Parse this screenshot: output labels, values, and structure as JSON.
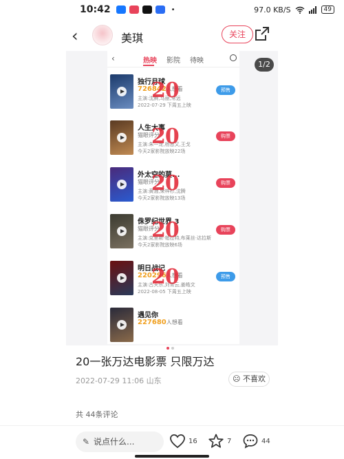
{
  "status_bar": {
    "time": "10:42",
    "app_icons": [
      {
        "name": "alipay-icon",
        "color": "#1677ff"
      },
      {
        "name": "mail-icon",
        "color": "#e8435a"
      },
      {
        "name": "tiktok-icon",
        "color": "#111111"
      },
      {
        "name": "app-icon",
        "color": "#2a6df4"
      }
    ],
    "dot": "•",
    "net_speed": "97.0 KB/S",
    "battery": "49"
  },
  "nav": {
    "author": "美琪",
    "follow_label": "关注",
    "page_indicator": "1/2"
  },
  "screenshot": {
    "tabs": [
      "热映",
      "影院",
      "待映"
    ],
    "stamp_text": "20",
    "movies": [
      {
        "title": "独行月球",
        "num": "726842",
        "num_suffix": "人想看",
        "line3": "主演:沈腾,马丽,常远",
        "line4": "2022-07-29 下周五上映",
        "button": "预售",
        "btn_color": "#3d9be9",
        "poster": [
          "#1b3a6b",
          "#6a8cc0"
        ]
      },
      {
        "title": "人生大事",
        "num": "",
        "num_suffix": "猫眼评分",
        "line3": "主演:朱一龙,杨恩又,王戈",
        "line4": "今天2家影院放映22场",
        "button": "购票",
        "btn_color": "#e8435a",
        "poster": [
          "#5a3a22",
          "#c08a52"
        ]
      },
      {
        "title": "外太空的莫...",
        "num": "",
        "num_suffix": "猫眼评分",
        "line3": "主演:黄渤,荣梓杉,沈腾",
        "line4": "今天2家影院放映13场",
        "button": "购票",
        "btn_color": "#e8435a",
        "poster": [
          "#4a2a7a",
          "#2a5bd0"
        ]
      },
      {
        "title": "侏罗纪世界 3",
        "num": "",
        "num_suffix": "猫眼评分",
        "line3": "主演:克里斯·帕拉特,布莱丝·达拉斯",
        "line4": "今天2家影院放映6场",
        "button": "购票",
        "btn_color": "#e8435a",
        "poster": [
          "#3b3b30",
          "#7a7060"
        ]
      },
      {
        "title": "明日战记",
        "num": "220296",
        "num_suffix": "人想看",
        "line3": "主演:古天乐,刘青云,姜皓文",
        "line4": "2022-08-05 下周五上映",
        "button": "预售",
        "btn_color": "#3d9be9",
        "poster": [
          "#6a1010",
          "#2a3a5a"
        ]
      },
      {
        "title": "遇见你",
        "num": "227680",
        "num_suffix": "人想看",
        "line3": "",
        "line4": "",
        "button": "",
        "btn_color": "#3d9be9",
        "poster": [
          "#2a2a3a",
          "#8a6a4a"
        ]
      }
    ]
  },
  "post": {
    "title": "20一张万达电影票 只限万达",
    "meta": "2022-07-29 11:06 山东",
    "dislike_label": "不喜欢",
    "comment_count": "共 44条评论"
  },
  "bottom": {
    "input_placeholder": "说点什么...",
    "likes": "16",
    "favorites": "7",
    "comments": "44"
  },
  "colors": {
    "accent": "#e8435a",
    "presale": "#3d9be9",
    "stamp": "#e12837"
  }
}
